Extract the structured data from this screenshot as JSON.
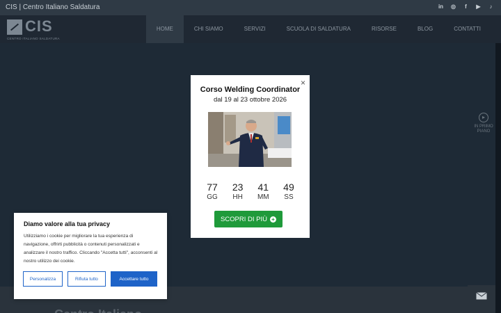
{
  "topbar": {
    "site_name": "CIS | Centro Italiano Saldatura",
    "socials": [
      "in",
      "◎",
      "f",
      "▶",
      "♪"
    ]
  },
  "header": {
    "logo_text": "CIS",
    "logo_sub": "CENTRO ITALIANO SALDATURA",
    "nav": [
      "HOME",
      "CHI SIAMO",
      "SERVIZI",
      "SCUOLA DI SALDATURA",
      "RISORSE",
      "BLOG",
      "CONTATTI"
    ],
    "active_nav": "HOME"
  },
  "side_widget": {
    "line1": "IN PRIMO",
    "line2": "PIANO"
  },
  "below": {
    "title": "Centro Italiano"
  },
  "modal": {
    "close": "×",
    "title": "Corso Welding Coordinator",
    "dates": "dal 19 al 23 ottobre 2026",
    "countdown": [
      {
        "value": "77",
        "label": "GG"
      },
      {
        "value": "23",
        "label": "HH"
      },
      {
        "value": "41",
        "label": "MM"
      },
      {
        "value": "49",
        "label": "SS"
      }
    ],
    "cta": "SCOPRI DI PIÙ"
  },
  "cookie": {
    "title": "Diamo valore alla tua privacy",
    "text": "Utilizziamo i cookie per migliorare la tua esperienza di navigazione, offrirti pubblicità o contenuti personalizzati e analizzare il nostro traffico. Cliccando \"Accetta tutti\", acconsenti al nostro utilizzo dei cookie.",
    "customize": "Personalizza",
    "reject": "Rifiuta tutto",
    "accept": "Accettare tutto"
  },
  "colors": {
    "cta_green": "#1f9a3a",
    "cookie_blue": "#1e63c8",
    "header_bg": "#1f2833"
  }
}
